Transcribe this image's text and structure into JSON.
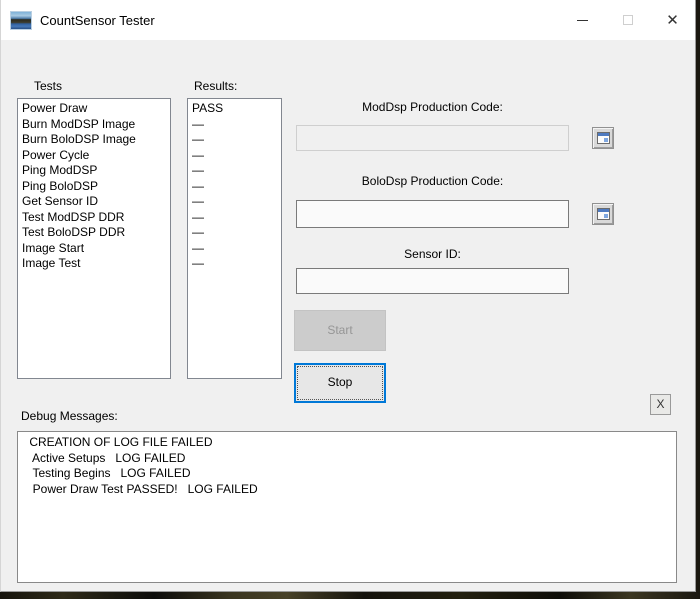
{
  "window": {
    "title": "CountSensor Tester",
    "controls": {
      "close_glyph": "✕"
    }
  },
  "tests": {
    "label": "Tests",
    "items": [
      "Power Draw",
      "Burn ModDSP Image",
      "Burn BoloDSP Image",
      "Power Cycle",
      "Ping ModDSP",
      "Ping BoloDSP",
      "Get Sensor ID",
      "Test ModDSP DDR",
      "Test BoloDSP DDR",
      "Image Start",
      "Image Test"
    ]
  },
  "results": {
    "label": "Results:",
    "items": [
      "PASS",
      "—",
      "—",
      "—",
      "—",
      "—",
      "—",
      "—",
      "—",
      "—",
      "—"
    ]
  },
  "form": {
    "moddsp_label": "ModDsp Production Code:",
    "moddsp_value": "",
    "bolodsp_label": "BoloDsp Production Code:",
    "bolodsp_value": "",
    "sensor_id_label": "Sensor ID:",
    "sensor_id_value": "",
    "start_label": "Start",
    "stop_label": "Stop",
    "x_button_label": "X"
  },
  "debug": {
    "label": "Debug Messages:",
    "lines": [
      " CREATION OF LOG FILE FAILED",
      "  Active Setups   LOG FAILED",
      "  Testing Begins   LOG FAILED",
      "  Power Draw Test PASSED!   LOG FAILED"
    ]
  },
  "colors": {
    "accent": "#0078d7",
    "window_bg": "#f0f0f0",
    "titlebar_bg": "#ffffff"
  }
}
